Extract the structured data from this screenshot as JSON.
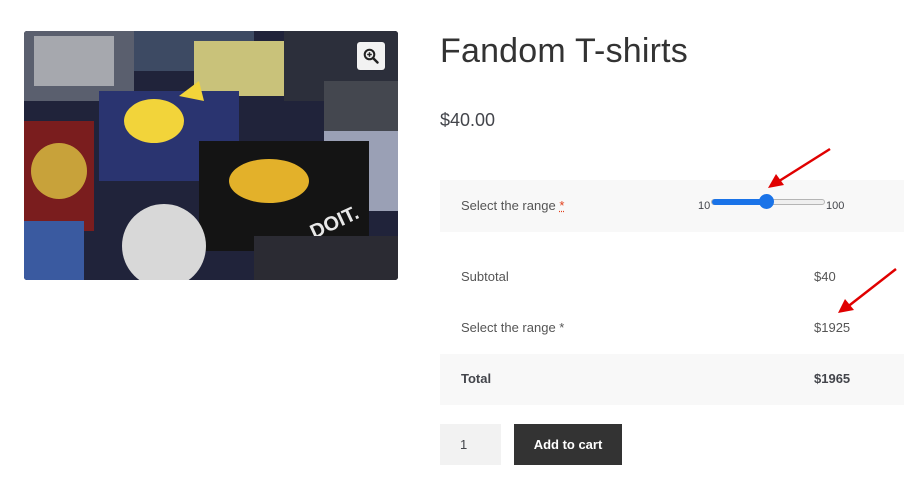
{
  "product": {
    "title": "Fandom T-shirts",
    "price": "$40.00",
    "image_alt": "Fandom T-shirts product photo"
  },
  "zoom": {
    "icon": "magnifier-zoom-icon"
  },
  "range_field": {
    "label": "Select the range",
    "required_mark": "*",
    "min": "10",
    "max": "100",
    "value_fraction": 0.49,
    "accent": "#1a73e8"
  },
  "totals": {
    "rows": [
      {
        "label": "Subtotal",
        "value": "$40"
      },
      {
        "label": "Select the range *",
        "value": "$1925"
      }
    ],
    "total_label": "Total",
    "total_value": "$1965"
  },
  "cart": {
    "quantity": "1",
    "add_label": "Add to cart"
  },
  "annotation_color": "#e00000"
}
